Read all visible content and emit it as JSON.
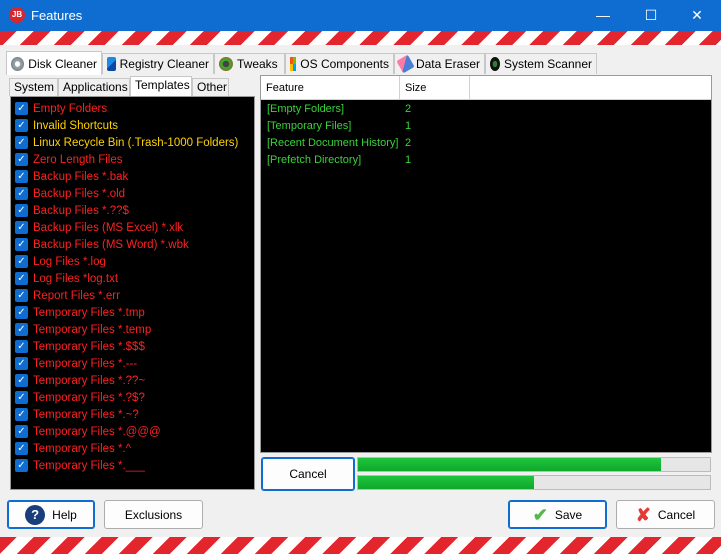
{
  "window": {
    "title": "Features",
    "app_icon_text": "JB",
    "accent": "#0f6cd0"
  },
  "tabs": [
    {
      "label": "Disk Cleaner",
      "icon": "disk-icon"
    },
    {
      "label": "Registry Cleaner",
      "icon": "registry-icon"
    },
    {
      "label": "Tweaks",
      "icon": "gauge-icon"
    },
    {
      "label": "OS Components",
      "icon": "windows-icon"
    },
    {
      "label": "Data Eraser",
      "icon": "eraser-icon"
    },
    {
      "label": "System Scanner",
      "icon": "scanner-icon"
    }
  ],
  "subtabs": [
    "System",
    "Applications",
    "Templates",
    "Other"
  ],
  "features": [
    {
      "label": "Empty Folders",
      "color": "#ff2020"
    },
    {
      "label": "Invalid Shortcuts",
      "color": "#ffd400"
    },
    {
      "label": "Linux Recycle Bin (.Trash-1000 Folders)",
      "color": "#ffd400"
    },
    {
      "label": "Zero Length Files",
      "color": "#ff2020"
    },
    {
      "label": "Backup Files *.bak",
      "color": "#ff2020"
    },
    {
      "label": "Backup Files *.old",
      "color": "#ff2020"
    },
    {
      "label": "Backup Files *.??$",
      "color": "#ff2020"
    },
    {
      "label": "Backup Files (MS Excel) *.xlk",
      "color": "#ff2020"
    },
    {
      "label": "Backup Files (MS Word) *.wbk",
      "color": "#ff2020"
    },
    {
      "label": "Log Files *.log",
      "color": "#ff2020"
    },
    {
      "label": "Log Files *log.txt",
      "color": "#ff2020"
    },
    {
      "label": "Report Files *.err",
      "color": "#ff2020"
    },
    {
      "label": "Temporary Files *.tmp",
      "color": "#ff2020"
    },
    {
      "label": "Temporary Files *.temp",
      "color": "#ff2020"
    },
    {
      "label": "Temporary Files *.$$$",
      "color": "#ff2020"
    },
    {
      "label": "Temporary Files *.---",
      "color": "#ff2020"
    },
    {
      "label": "Temporary Files *.??~",
      "color": "#ff2020"
    },
    {
      "label": "Temporary Files *.?$?",
      "color": "#ff2020"
    },
    {
      "label": "Temporary Files *.~?",
      "color": "#ff2020"
    },
    {
      "label": "Temporary Files *.@@@",
      "color": "#ff2020"
    },
    {
      "label": "Temporary Files *.^",
      "color": "#ff2020"
    },
    {
      "label": "Temporary Files *.___",
      "color": "#ff2020"
    }
  ],
  "results": {
    "columns": [
      "Feature",
      "Size"
    ],
    "rows": [
      {
        "feature": "[Empty Folders]",
        "size": "2"
      },
      {
        "feature": "[Temporary Files]",
        "size": "1"
      },
      {
        "feature": "[Recent Document History]",
        "size": "2"
      },
      {
        "feature": "[Prefetch Directory]",
        "size": "1"
      }
    ]
  },
  "scan": {
    "cancel_label": "Cancel",
    "progress_primary": 0.86,
    "progress_secondary": 0.5
  },
  "footer": {
    "help_label": "Help",
    "exclusions_label": "Exclusions",
    "save_label": "Save",
    "cancel_label": "Cancel"
  }
}
